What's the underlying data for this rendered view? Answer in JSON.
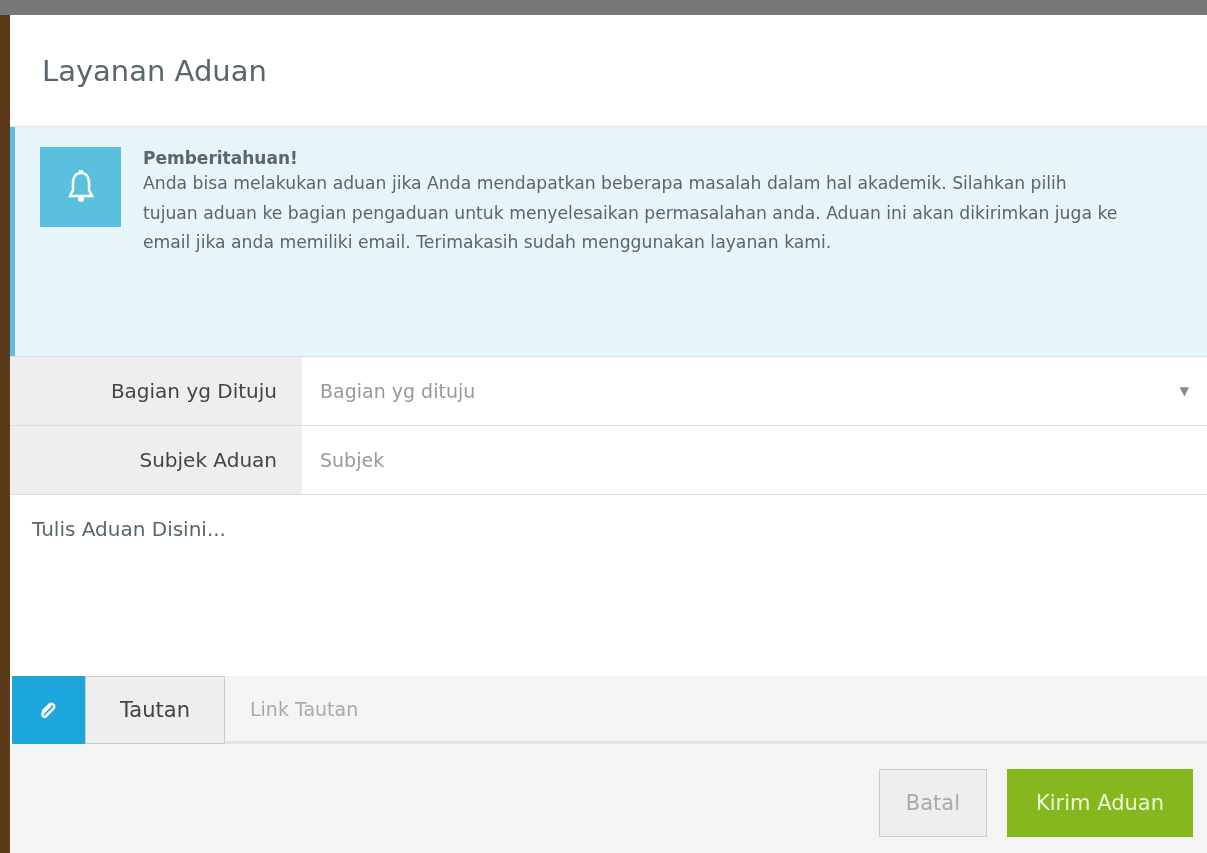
{
  "dialog": {
    "title": "Layanan Aduan",
    "alert": {
      "heading": "Pemberitahuan!",
      "message": "Anda bisa melakukan aduan jika Anda mendapatkan beberapa masalah dalam hal akademik. Silahkan pilih tujuan aduan ke bagian pengaduan untuk menyelesaikan permasalahan anda. Aduan ini akan dikirimkan juga ke email jika anda memiliki email. Terimakasih sudah menggunakan layanan kami."
    },
    "fields": [
      {
        "kind": "select",
        "label": "Bagian yg Dituju",
        "placeholder": "Bagian yg dituju",
        "caret": "▼"
      },
      {
        "kind": "text",
        "label": "Subjek Aduan",
        "placeholder": "Subjek"
      }
    ],
    "textarea": {
      "placeholder": "Tulis Aduan Disini..."
    },
    "link": {
      "label": "Tautan",
      "placeholder": "Link Tautan"
    },
    "buttons": [
      {
        "label": "Batal",
        "kind": "cancel",
        "disabled": true
      },
      {
        "label": "Kirim Aduan",
        "kind": "primary",
        "disabled": false
      }
    ]
  }
}
